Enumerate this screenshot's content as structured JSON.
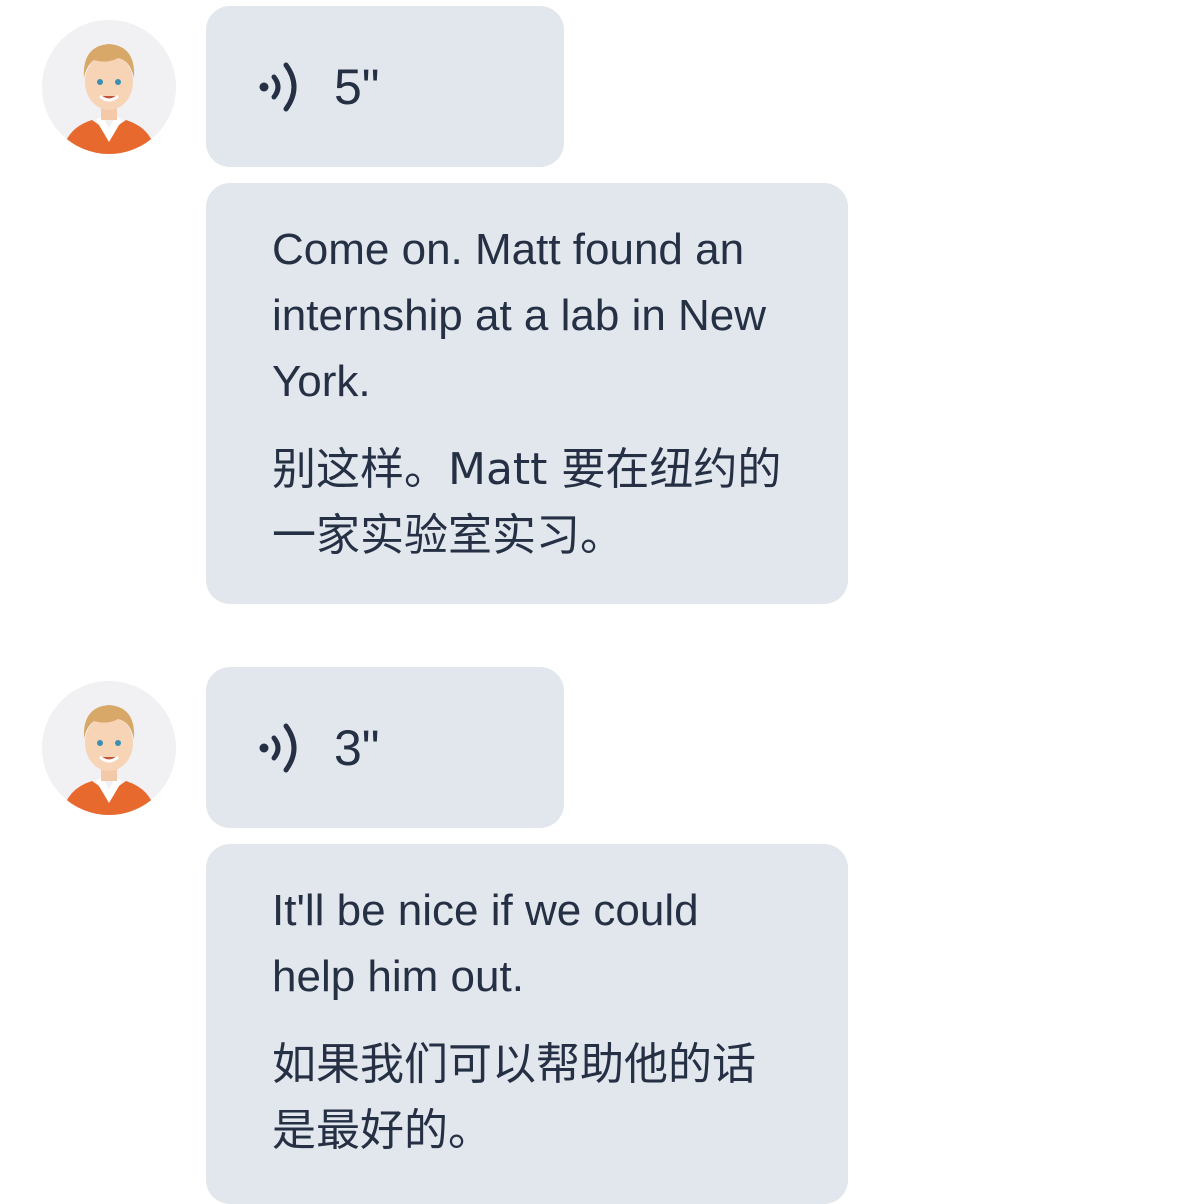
{
  "colors": {
    "bubble_bg": "#e2e6ed",
    "text": "#253044",
    "avatar_bg": "#f1f1f3",
    "avatar_shirt": "#e8692e"
  },
  "messages": [
    {
      "avatar_icon": "male-avatar-icon",
      "voice_icon": "sound-wave-icon",
      "duration": "5\"",
      "text_en": "Come on. Matt found an internship at a lab in New York.",
      "text_zh": "别这样。Matt 要在纽约的一家实验室实习。"
    },
    {
      "avatar_icon": "male-avatar-icon",
      "voice_icon": "sound-wave-icon",
      "duration": "3\"",
      "text_en": "It'll be nice if we could help him out.",
      "text_zh": "如果我们可以帮助他的话是最好的。"
    }
  ]
}
